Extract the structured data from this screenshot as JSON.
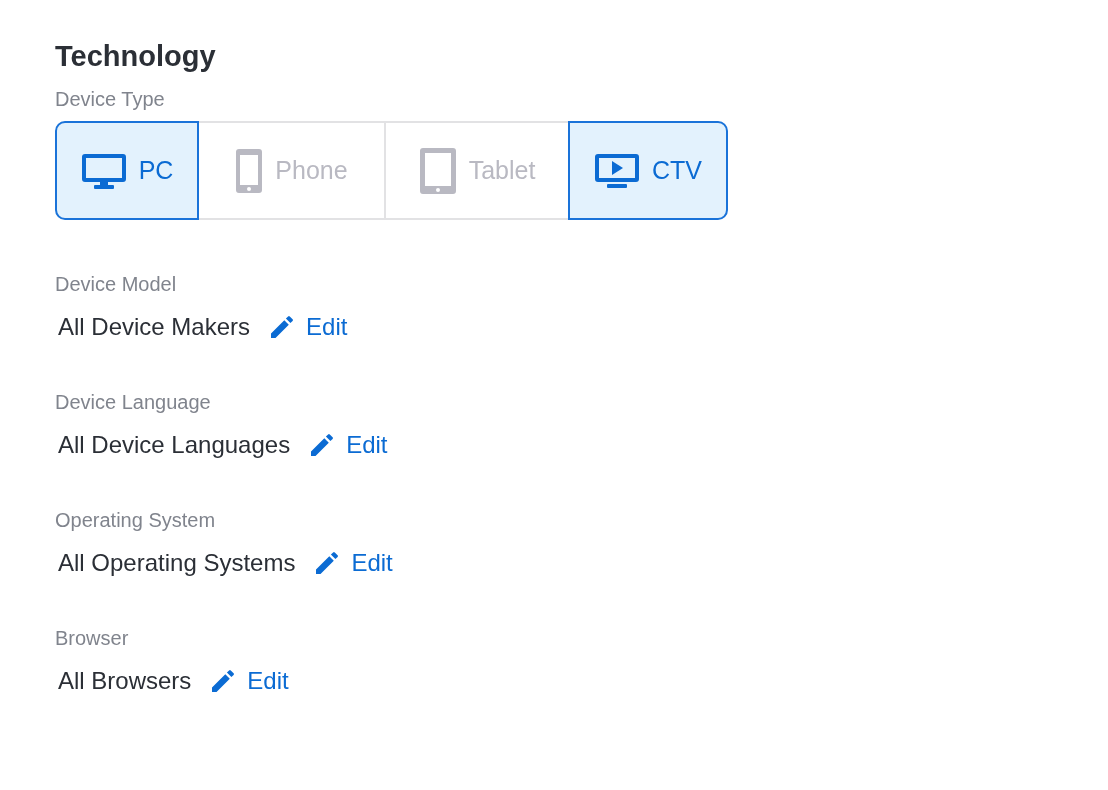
{
  "section_title": "Technology",
  "device_type": {
    "label": "Device Type",
    "options": [
      {
        "kind": "pc",
        "label": "PC",
        "selected": true
      },
      {
        "kind": "phone",
        "label": "Phone",
        "selected": false
      },
      {
        "kind": "tablet",
        "label": "Tablet",
        "selected": false
      },
      {
        "kind": "ctv",
        "label": "CTV",
        "selected": true
      }
    ]
  },
  "settings": [
    {
      "label": "Device Model",
      "value": "All Device Makers",
      "action": "Edit"
    },
    {
      "label": "Device Language",
      "value": "All Device Languages",
      "action": "Edit"
    },
    {
      "label": "Operating System",
      "value": "All Operating Systems",
      "action": "Edit"
    },
    {
      "label": "Browser",
      "value": "All Browsers",
      "action": "Edit"
    }
  ]
}
